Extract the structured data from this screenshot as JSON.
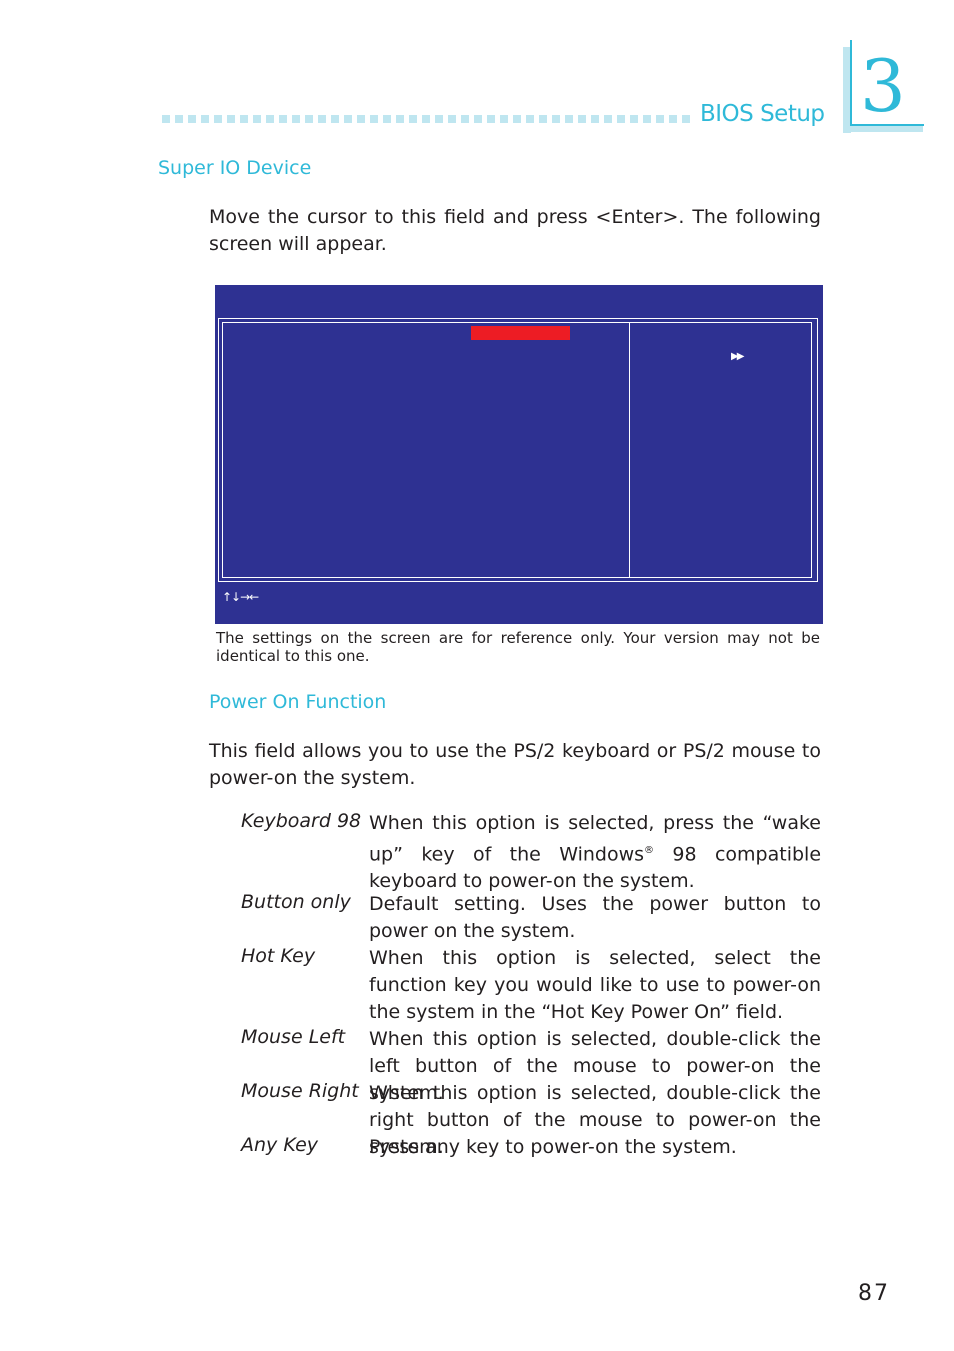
{
  "header": {
    "section_title": "BIOS Setup",
    "chapter_number": "3",
    "accent_color": "#2fb9d8"
  },
  "super_io": {
    "heading": "Super IO Device",
    "intro": "Move the cursor to this field and press <Enter>. The following screen will appear."
  },
  "bios_screen": {
    "background_color": "#2e3192",
    "highlight_color": "#ed1c24",
    "submenu_marker": "▶▶",
    "nav_keys": "↑↓→←"
  },
  "caption": "The settings on the screen are for reference only. Your version may not be identical to this one.",
  "power_on": {
    "heading": "Power On Function",
    "intro": "This field allows you to use the PS/2 keyboard or PS/2 mouse to power-on the system.",
    "options": [
      {
        "term": "Keyboard 98",
        "desc_a": "When this option is selected, press the “wake up” key of the Windows",
        "desc_sup": "®",
        "desc_b": " 98 compatible keyboard to power-on the system."
      },
      {
        "term": "Button only",
        "desc": "Default setting. Uses the power button to power on the system."
      },
      {
        "term": "Hot Key",
        "desc": "When this option is selected, select the function key you would like to use to power-on the system in the “Hot Key Power On” field."
      },
      {
        "term": "Mouse Left",
        "desc": "When this option is selected, double-click the left button of the mouse to power-on the system."
      },
      {
        "term": "Mouse Right",
        "desc": "When this option is selected, double-click the right button of the mouse to power-on the system."
      },
      {
        "term": "Any Key",
        "desc": "Press any key to power-on the system."
      }
    ]
  },
  "page_number": "87"
}
